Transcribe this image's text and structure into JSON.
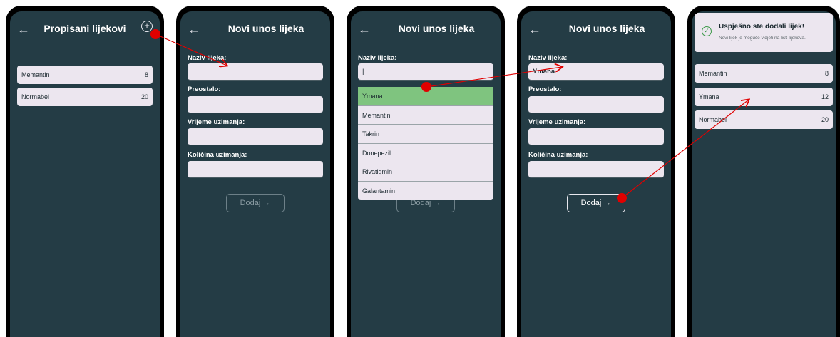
{
  "screen1": {
    "title": "Propisani lijekovi",
    "back_icon": "arrow-left-icon",
    "add_icon": "plus-circle-icon",
    "meds": [
      {
        "name": "Memantin",
        "count": "8"
      },
      {
        "name": "Normabel",
        "count": "20"
      }
    ]
  },
  "screen2": {
    "title": "Novi unos lijeka",
    "labels": {
      "name": "Naziv lijeka:",
      "remaining": "Preostalo:",
      "time": "Vrijeme uzimanja:",
      "amount": "Količina uzimanja:"
    },
    "submit": "Dodaj →"
  },
  "screen3": {
    "title": "Novi unos lijeka",
    "name_label": "Naziv lijeka:",
    "name_value": "|",
    "options": [
      "Ymana",
      "Memantin",
      "Takrin",
      "Donepezil",
      "Rivatigmin",
      "Galantamin"
    ],
    "selected": "Ymana",
    "submit": "Dodaj →"
  },
  "screen4": {
    "title": "Novi unos lijeka",
    "labels": {
      "name": "Naziv lijeka:",
      "remaining": "Preostalo:",
      "time": "Vrijeme uzimanja:",
      "amount": "Količina uzimanja:"
    },
    "name_value": "Ymana",
    "submit": "Dodaj →"
  },
  "screen5": {
    "toast_title": "Uspješno ste dodali lijek!",
    "toast_text": "Novi lijek je moguće vidjeti na listi lijekova.",
    "meds": [
      {
        "name": "Memantin",
        "count": "8"
      },
      {
        "name": "Ymana",
        "count": "12"
      },
      {
        "name": "Normabel",
        "count": "20"
      }
    ]
  },
  "colors": {
    "screen_bg": "#243c45",
    "field_bg": "#ece6ef",
    "highlight": "#7fc47f",
    "annotation": "#e00000"
  }
}
